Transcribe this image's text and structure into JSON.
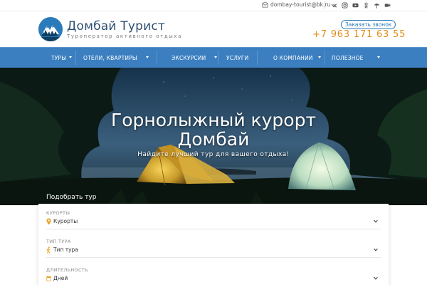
{
  "topbar": {
    "email": "dombay-tourist@bk.ru",
    "socials": [
      "vk-icon",
      "instagram-icon",
      "youtube-icon",
      "odnoklassniki-icon",
      "umbrella-icon",
      "video-icon"
    ]
  },
  "header": {
    "brand_name": "Домбай Турист",
    "brand_tagline": "Туроператор активного отдыха",
    "callback_label": "Заказать звонок",
    "phone": "+7 963 171 63 55"
  },
  "nav": {
    "items": [
      {
        "label": "Туры",
        "has_dropdown": true
      },
      {
        "label": "Отели, квартиры",
        "has_dropdown": true
      },
      {
        "label": "Экскурсии",
        "has_dropdown": true
      },
      {
        "label": "Услуги",
        "has_dropdown": false
      },
      {
        "label": "О компании",
        "has_dropdown": true
      },
      {
        "label": "Полезное",
        "has_dropdown": true
      }
    ]
  },
  "hero": {
    "title_line1": "Горнолыжный курорт",
    "title_line2": "Домбай",
    "subtitle": "Найдите лучший тур для вашего отдыха!",
    "pick_label": "Подобрать тур"
  },
  "search": {
    "fields": [
      {
        "label": "Курорты",
        "value": "Курорты",
        "icon": "map-pin-icon"
      },
      {
        "label": "Тип тура",
        "value": "Тип тура",
        "icon": "hiker-icon"
      },
      {
        "label": "Длительность",
        "value": "Дней",
        "icon": "calendar-icon"
      }
    ]
  },
  "colors": {
    "brand_blue": "#3b7fc0",
    "phone_orange": "#e38c1a",
    "brand_text": "#2d4f72"
  }
}
